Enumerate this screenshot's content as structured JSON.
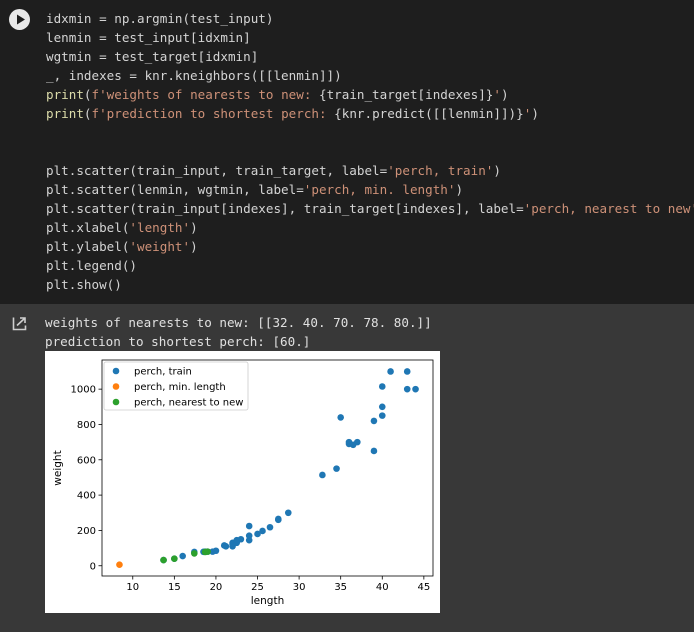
{
  "code_lines": [
    [
      {
        "t": "idxmin = np.argmin(test_input)",
        "c": ""
      }
    ],
    [
      {
        "t": "lenmin = test_input[idxmin]",
        "c": ""
      }
    ],
    [
      {
        "t": "wgtmin = test_target[idxmin]",
        "c": ""
      }
    ],
    [
      {
        "t": "_, indexes = knr.kneighbors([[lenmin]])",
        "c": ""
      }
    ],
    [
      {
        "t": "print",
        "c": "kw"
      },
      {
        "t": "(",
        "c": ""
      },
      {
        "t": "f'weights of nearests to new: ",
        "c": "str"
      },
      {
        "t": "{train_target[indexes]}",
        "c": ""
      },
      {
        "t": "'",
        "c": "str"
      },
      {
        "t": ")",
        "c": ""
      }
    ],
    [
      {
        "t": "print",
        "c": "kw"
      },
      {
        "t": "(",
        "c": ""
      },
      {
        "t": "f'prediction to shortest perch: ",
        "c": "str"
      },
      {
        "t": "{knr.predict([[lenmin]])}",
        "c": ""
      },
      {
        "t": "'",
        "c": "str"
      },
      {
        "t": ")",
        "c": ""
      }
    ],
    [],
    [],
    [
      {
        "t": "plt.scatter(train_input, train_target, label=",
        "c": ""
      },
      {
        "t": "'perch, train'",
        "c": "str"
      },
      {
        "t": ")",
        "c": ""
      }
    ],
    [
      {
        "t": "plt.scatter(lenmin, wgtmin, label=",
        "c": ""
      },
      {
        "t": "'perch, min. length'",
        "c": "str"
      },
      {
        "t": ")",
        "c": ""
      }
    ],
    [
      {
        "t": "plt.scatter(train_input[indexes], train_target[indexes], label=",
        "c": ""
      },
      {
        "t": "'perch, nearest to new'",
        "c": "str"
      },
      {
        "t": ")",
        "c": ""
      }
    ],
    [
      {
        "t": "plt.xlabel(",
        "c": ""
      },
      {
        "t": "'length'",
        "c": "str"
      },
      {
        "t": ")",
        "c": ""
      }
    ],
    [
      {
        "t": "plt.ylabel(",
        "c": ""
      },
      {
        "t": "'weight'",
        "c": "str"
      },
      {
        "t": ")",
        "c": ""
      }
    ],
    [
      {
        "t": "plt.legend()",
        "c": ""
      }
    ],
    [
      {
        "t": "plt.show()",
        "c": ""
      }
    ]
  ],
  "output": {
    "lines": [
      "weights of nearests to new: [[32. 40. 70. 78. 80.]]",
      "prediction to shortest perch: [60.]"
    ]
  },
  "chart_data": {
    "type": "scatter",
    "xlabel": "length",
    "ylabel": "weight",
    "xlim": [
      6.3,
      46.1
    ],
    "ylim": [
      -58,
      1165
    ],
    "xticks": [
      10,
      15,
      20,
      25,
      30,
      35,
      40,
      45
    ],
    "yticks": [
      0,
      200,
      400,
      600,
      800,
      1000
    ],
    "grid": false,
    "legend_position": "upper-left",
    "series": [
      {
        "name": "perch, train",
        "color": "#1f77b4",
        "points": [
          [
            19.6,
            80
          ],
          [
            22.0,
            120
          ],
          [
            18.7,
            80
          ],
          [
            17.4,
            78
          ],
          [
            36.0,
            700
          ],
          [
            25.0,
            180
          ],
          [
            40.0,
            850
          ],
          [
            39.0,
            820
          ],
          [
            43.0,
            1000
          ],
          [
            22.0,
            130
          ],
          [
            20.0,
            85
          ],
          [
            22.0,
            110
          ],
          [
            24.0,
            225
          ],
          [
            27.5,
            260
          ],
          [
            43.0,
            1100
          ],
          [
            40.0,
            900
          ],
          [
            24.0,
            145
          ],
          [
            21.0,
            115
          ],
          [
            27.5,
            265
          ],
          [
            40.0,
            1015
          ],
          [
            41.0,
            1100
          ],
          [
            36.0,
            690
          ],
          [
            37.0,
            700
          ],
          [
            44.0,
            1000
          ],
          [
            22.5,
            130
          ],
          [
            15.0,
            40
          ],
          [
            39.0,
            650
          ],
          [
            35.0,
            840
          ],
          [
            23.0,
            150
          ],
          [
            28.7,
            300
          ],
          [
            34.5,
            550
          ],
          [
            25.6,
            197
          ],
          [
            26.5,
            218
          ],
          [
            21.2,
            110
          ],
          [
            32.8,
            514
          ],
          [
            24.0,
            170
          ],
          [
            22.5,
            145
          ],
          [
            36.5,
            685
          ],
          [
            13.7,
            32
          ],
          [
            18.5,
            79
          ],
          [
            16.0,
            55
          ],
          [
            19.0,
            80
          ]
        ]
      },
      {
        "name": "perch, min. length",
        "color": "#ff7f0e",
        "points": [
          [
            8.4,
            5.9
          ]
        ]
      },
      {
        "name": "perch, nearest to new",
        "color": "#2ca02c",
        "points": [
          [
            13.7,
            32
          ],
          [
            15.0,
            40
          ],
          [
            17.4,
            70
          ],
          [
            18.7,
            78
          ],
          [
            19.0,
            80
          ]
        ]
      }
    ]
  }
}
